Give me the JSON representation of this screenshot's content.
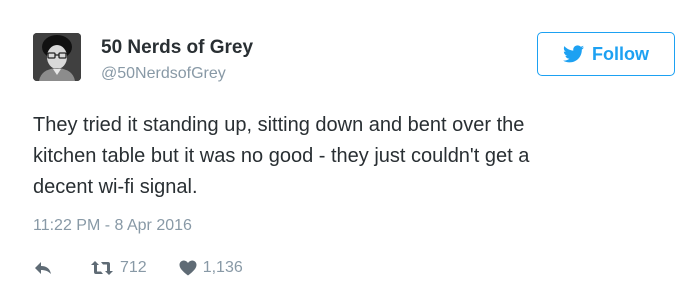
{
  "user": {
    "display_name": "50 Nerds of Grey",
    "handle": "@50NerdsofGrey",
    "avatar_icon": "avatar-photo"
  },
  "follow_button": {
    "label": "Follow",
    "icon": "twitter-bird-icon"
  },
  "tweet": {
    "text_lines": [
      "They tried it standing up, sitting down and bent over the",
      "kitchen table but it was no good - they just couldn't get a",
      "decent wi-fi signal."
    ],
    "timestamp": "11:22 PM - 8 Apr 2016"
  },
  "actions": {
    "reply": {
      "icon": "reply-icon"
    },
    "retweet": {
      "icon": "retweet-icon",
      "count": "712"
    },
    "like": {
      "icon": "heart-icon",
      "count": "1,136"
    }
  },
  "colors": {
    "accent": "#1da1f2",
    "text": "#292f33",
    "muted": "#8899a6"
  }
}
